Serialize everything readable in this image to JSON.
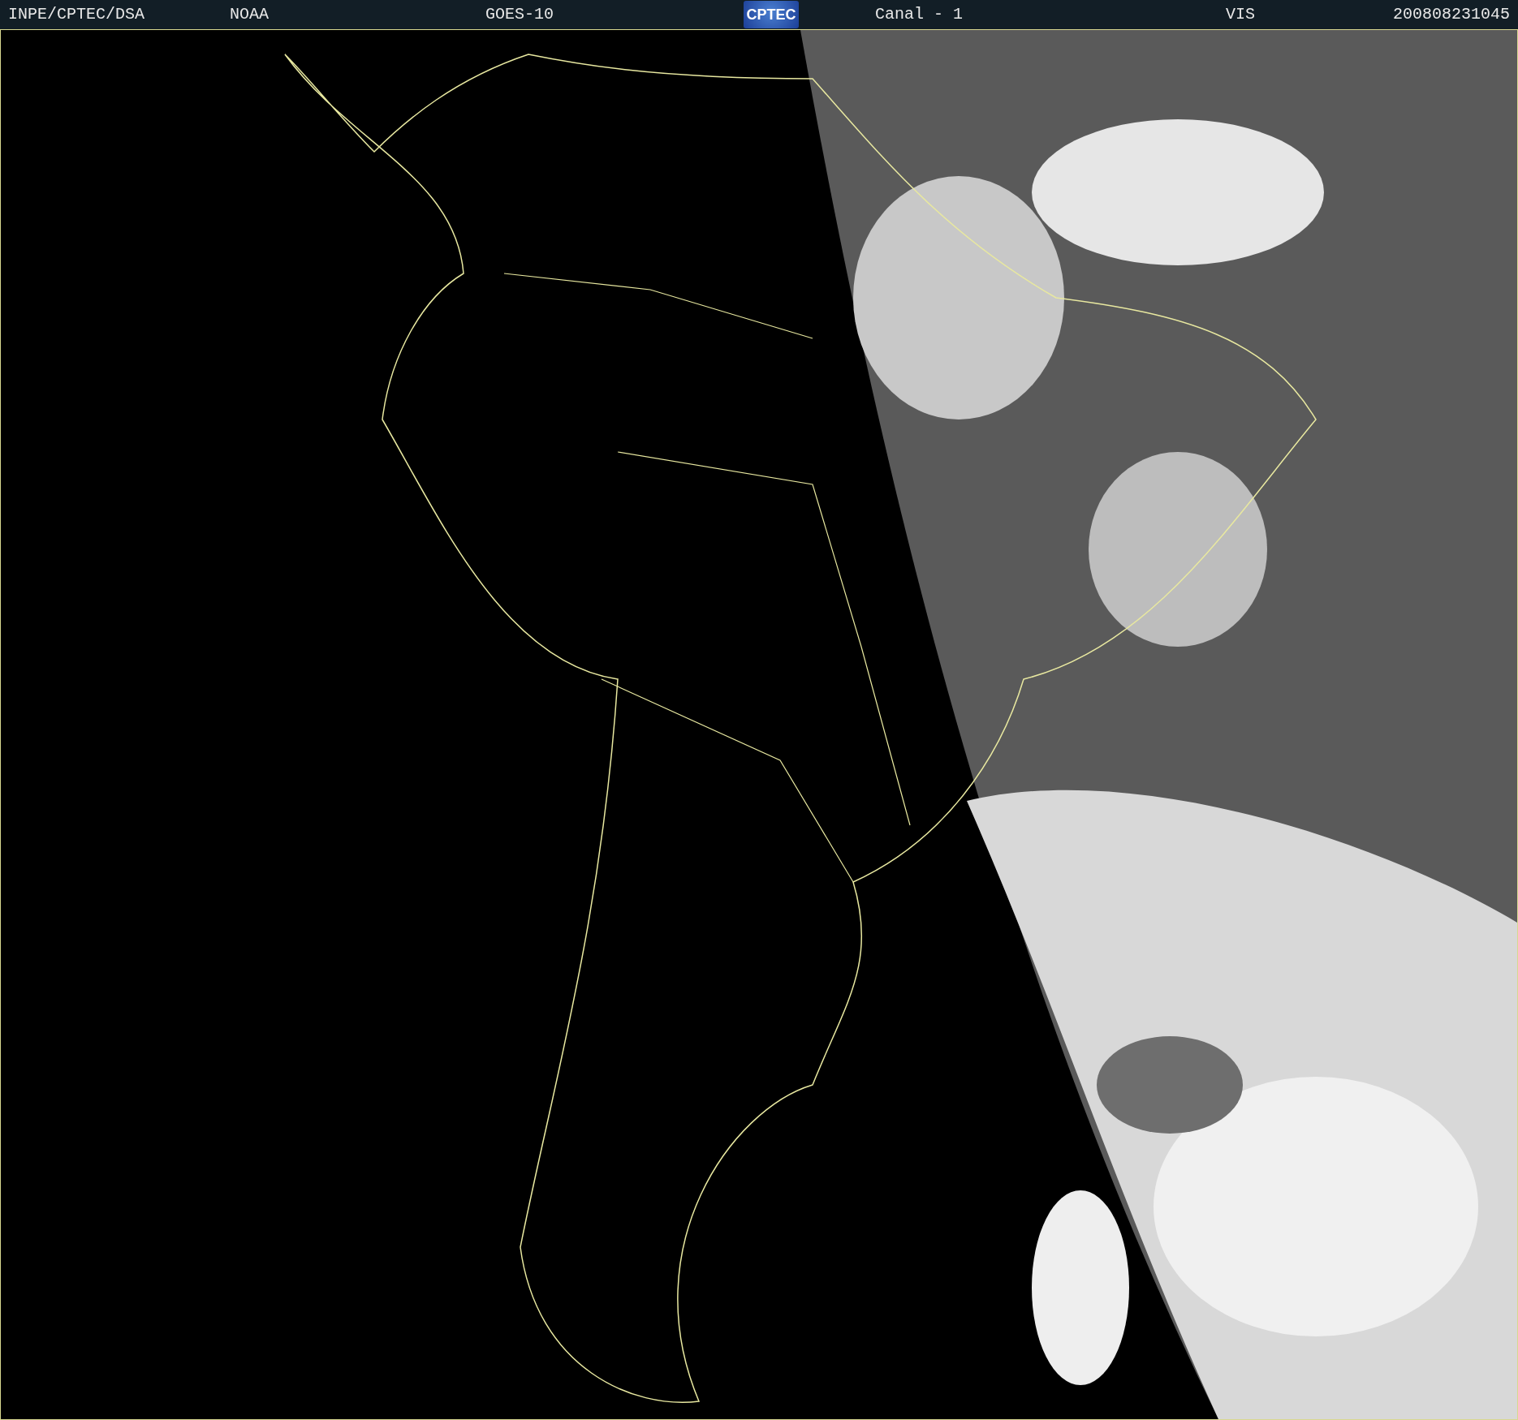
{
  "header": {
    "credit": "INPE/CPTEC/DSA",
    "agency": "NOAA",
    "satellite": "GOES-10",
    "logo": "CPTEC",
    "channel": "Canal - 1",
    "band": "VIS",
    "timestamp": "200808231045"
  }
}
